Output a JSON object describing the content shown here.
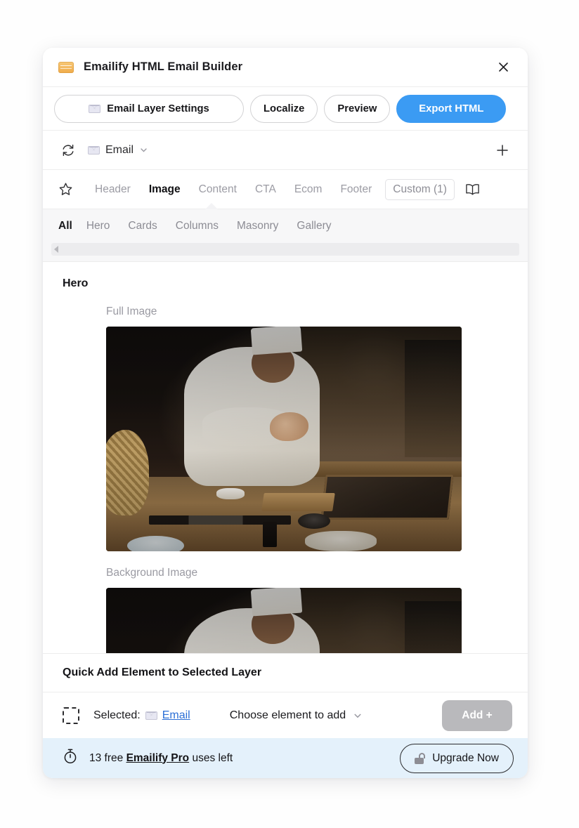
{
  "window": {
    "title": "Emailify HTML Email Builder",
    "app_icon": "envelope-icon",
    "close_icon": "close-icon"
  },
  "actionbar": {
    "buttons": [
      {
        "label": "Email Layer Settings",
        "icon": "envelope-icon",
        "style": "outline"
      },
      {
        "label": "Localize",
        "style": "outline"
      },
      {
        "label": "Preview",
        "style": "outline"
      },
      {
        "label": "Export HTML",
        "style": "primary"
      }
    ],
    "primary_color": "#3b9bf3"
  },
  "layerbar": {
    "sync_icon": "sync-icon",
    "layer_icon": "envelope-icon",
    "layer_name": "Email",
    "chevron_icon": "chevron-down-icon",
    "add_icon": "plus-icon"
  },
  "category_tabs": {
    "star_icon": "star-icon",
    "book_icon": "book-icon",
    "items": [
      {
        "label": "Header",
        "active": false
      },
      {
        "label": "Image",
        "active": true
      },
      {
        "label": "Content",
        "active": false
      },
      {
        "label": "CTA",
        "active": false
      },
      {
        "label": "Ecom",
        "active": false
      },
      {
        "label": "Footer",
        "active": false
      },
      {
        "label": "Custom (1)",
        "active": false,
        "boxed": true
      }
    ]
  },
  "sub_tabs": {
    "items": [
      {
        "label": "All",
        "active": true
      },
      {
        "label": "Hero",
        "active": false
      },
      {
        "label": "Cards",
        "active": false
      },
      {
        "label": "Columns",
        "active": false
      },
      {
        "label": "Masonry",
        "active": false
      },
      {
        "label": "Gallery",
        "active": false
      }
    ],
    "scroll_arrow_icon": "caret-left-icon"
  },
  "content": {
    "section_title": "Hero",
    "items": [
      {
        "label": "Full Image"
      },
      {
        "label": "Background Image"
      }
    ]
  },
  "quick_add": {
    "heading": "Quick Add Element to Selected Layer",
    "selection_icon": "dashed-selection-icon",
    "selected_label": "Selected:",
    "selected_layer_icon": "envelope-icon",
    "selected_layer": "Email",
    "chooser_label": "Choose element to add",
    "chooser_chevron": "chevron-down-icon",
    "add_button": "Add +",
    "add_button_disabled": true
  },
  "footer": {
    "timer_icon": "stopwatch-icon",
    "text_prefix": "13 free ",
    "text_brand": "Emailify Pro",
    "text_suffix": " uses left",
    "upgrade_label": "Upgrade Now",
    "lock_icon": "unlock-icon",
    "background_color": "#e4f1fb"
  }
}
